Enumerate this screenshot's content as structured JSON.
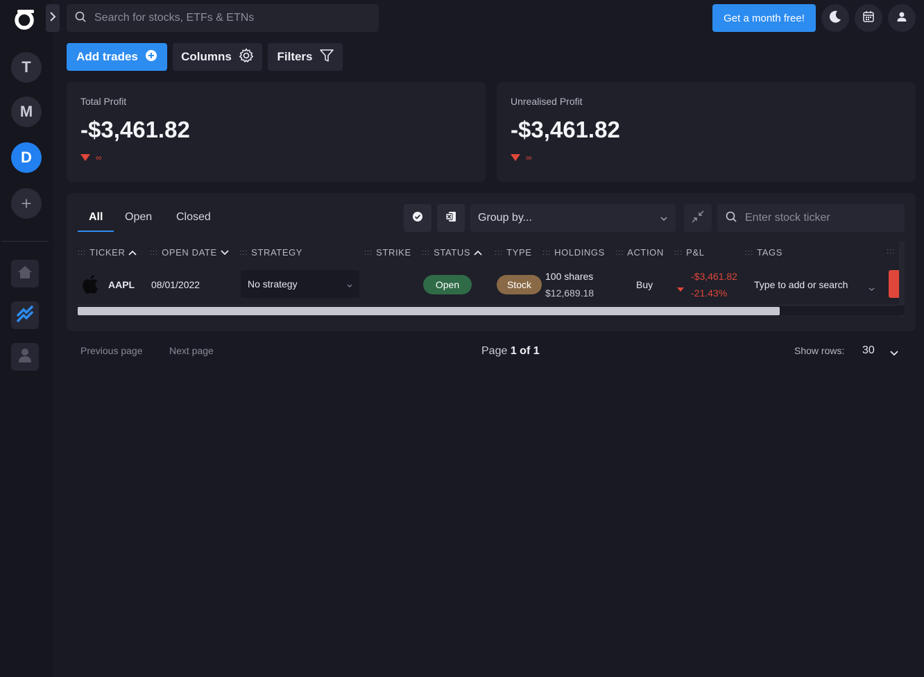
{
  "sidebar": {
    "workspaces": [
      {
        "initial": "T",
        "active": false
      },
      {
        "initial": "M",
        "active": false
      },
      {
        "initial": "D",
        "active": true
      }
    ],
    "add_symbol": "+",
    "nav_icons": [
      "home-icon",
      "trades-icon",
      "user-icon"
    ]
  },
  "topbar": {
    "search_placeholder": "Search for stocks, ETFs & ETNs",
    "promo_label": "Get a month free!",
    "icons": [
      "moon-icon",
      "calendar-icon",
      "account-icon"
    ]
  },
  "toolbar": {
    "add_trades_label": "Add trades",
    "columns_label": "Columns",
    "filters_label": "Filters"
  },
  "cards": {
    "total_profit": {
      "label": "Total Profit",
      "value": "-$3,461.82",
      "delta": "∞"
    },
    "unrealised_profit": {
      "label": "Unrealised Profit",
      "value": "-$3,461.82",
      "delta": "∞"
    }
  },
  "table": {
    "tabs": [
      {
        "label": "All",
        "active": true
      },
      {
        "label": "Open",
        "active": false
      },
      {
        "label": "Closed",
        "active": false
      }
    ],
    "group_by_placeholder": "Group by...",
    "ticker_search_placeholder": "Enter stock ticker",
    "columns": {
      "ticker": "TICKER",
      "open_date": "OPEN DATE",
      "strategy": "STRATEGY",
      "strike": "STRIKE",
      "status": "STATUS",
      "type": "TYPE",
      "holdings": "HOLDINGS",
      "action": "ACTION",
      "pnl": "P&L",
      "tags": "TAGS"
    },
    "rows": [
      {
        "ticker": "AAPL",
        "open_date": "08/01/2022",
        "strategy": "No strategy",
        "strike": "",
        "status": "Open",
        "type": "Stock",
        "holdings_shares": "100 shares",
        "holdings_value": "$12,689.18",
        "action": "Buy",
        "pnl_value": "-$3,461.82",
        "pnl_percent": "-21.43%",
        "tags_placeholder": "Type to add or search"
      }
    ]
  },
  "pagination": {
    "previous_label": "Previous page",
    "next_label": "Next page",
    "page_prefix": "Page",
    "page_value": "1 of 1",
    "show_rows_label": "Show rows:",
    "show_rows_value": "30"
  },
  "colors": {
    "accent": "#2d8cf0",
    "negative": "#e0463a",
    "open_status": "#2f6b47",
    "stock_type": "#8a6a46",
    "background": "#181922"
  }
}
